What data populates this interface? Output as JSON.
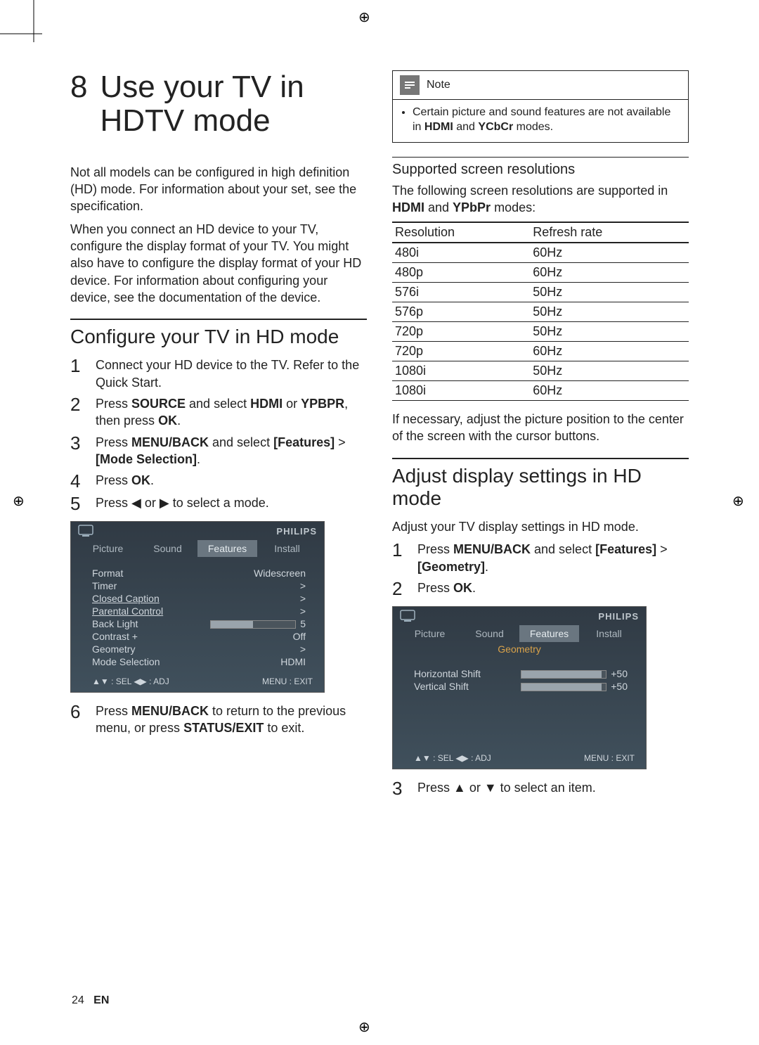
{
  "chapter": {
    "number": "8",
    "title": "Use your TV in HDTV mode"
  },
  "intro": {
    "p1": "Not all models can be configured in high definition (HD) mode. For information about your set, see the specification.",
    "p2": "When you connect an HD device to your TV, configure the display format of your TV. You might also have to configure the display format of your HD device. For information about configuring your device, see the documentation of the device."
  },
  "section1": {
    "title": "Configure your TV in HD mode",
    "steps": [
      "Connect your HD device to the TV. Refer to the Quick Start.",
      "Press SOURCE and select HDMI or YPBPR, then press OK.",
      "Press MENU/BACK and select [Features] > [Mode Selection].",
      "Press OK.",
      "Press ◀ or ▶ to select a mode."
    ],
    "step6": "Press MENU/BACK to return to the previous menu, or press STATUS/EXIT to exit."
  },
  "osd1": {
    "brand": "PHILIPS",
    "tabs": [
      "Picture",
      "Sound",
      "Features",
      "Install"
    ],
    "selectedTab": "Features",
    "rows": [
      {
        "l": "Format",
        "r": "Widescreen"
      },
      {
        "l": "Timer",
        "r": ">"
      },
      {
        "l": "Closed Caption",
        "r": ">"
      },
      {
        "l": "Parental Control",
        "r": ">"
      },
      {
        "l": "Back Light",
        "r": "slider",
        "v": "5"
      },
      {
        "l": "Contrast +",
        "r": "Off"
      },
      {
        "l": "Geometry",
        "r": ">"
      },
      {
        "l": "Mode Selection",
        "r": "HDMI"
      }
    ],
    "foot_l": "▲▼ : SEL  ◀▶ : ADJ",
    "foot_r": "MENU : EXIT"
  },
  "note": {
    "label": "Note",
    "text": "Certain picture and sound features are not available in HDMI and YCbCr modes."
  },
  "subsection": {
    "title": "Supported screen resolutions",
    "lead": "The following screen resolutions are supported in HDMI and YPbPr modes:",
    "headers": [
      "Resolution",
      "Refresh rate"
    ],
    "rows": [
      [
        "480i",
        "60Hz"
      ],
      [
        "480p",
        "60Hz"
      ],
      [
        "576i",
        "50Hz"
      ],
      [
        "576p",
        "50Hz"
      ],
      [
        "720p",
        "50Hz"
      ],
      [
        "720p",
        "60Hz"
      ],
      [
        "1080i",
        "50Hz"
      ],
      [
        "1080i",
        "60Hz"
      ]
    ],
    "after": "If necessary, adjust the picture position to the center of the screen with the cursor buttons."
  },
  "section2": {
    "title": "Adjust display settings in HD mode",
    "lead": "Adjust your TV display settings in HD mode.",
    "steps": [
      "Press MENU/BACK and select [Features] > [Geometry].",
      "Press OK."
    ],
    "step3": "Press ▲ or ▼ to select an item."
  },
  "osd2": {
    "brand": "PHILIPS",
    "tabs": [
      "Picture",
      "Sound",
      "Features",
      "Install"
    ],
    "selectedTab": "Features",
    "subtitle": "Geometry",
    "rows": [
      {
        "l": "Horizontal Shift",
        "v": "+50"
      },
      {
        "l": "Vertical Shift",
        "v": "+50"
      }
    ],
    "foot_l": "▲▼ : SEL  ◀▶ : ADJ",
    "foot_r": "MENU : EXIT"
  },
  "footer": {
    "page": "24",
    "lang": "EN"
  }
}
